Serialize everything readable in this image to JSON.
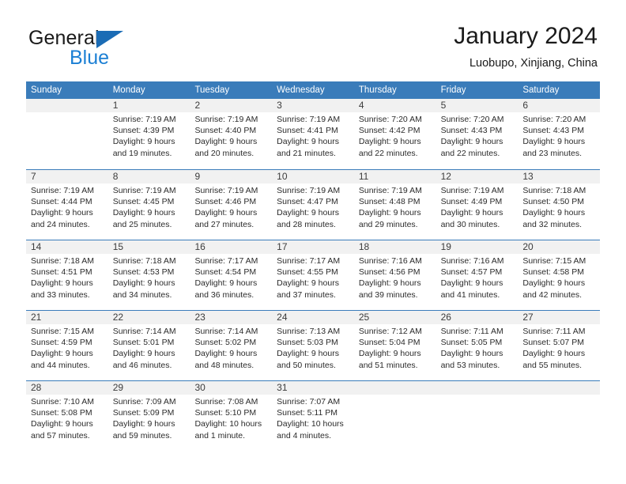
{
  "brand": {
    "name_part1": "General",
    "name_part2": "Blue",
    "color_primary": "#1b6cb5",
    "color_secondary": "#1b7fd4"
  },
  "header": {
    "title": "January 2024",
    "subtitle": "Luobupo, Xinjiang, China"
  },
  "calendar": {
    "header_bg": "#3a7cba",
    "header_text_color": "#ffffff",
    "weekdays": [
      "Sunday",
      "Monday",
      "Tuesday",
      "Wednesday",
      "Thursday",
      "Friday",
      "Saturday"
    ],
    "weeks": [
      [
        {
          "day": "",
          "sunrise": "",
          "sunset": "",
          "daylight_line1": "",
          "daylight_line2": ""
        },
        {
          "day": "1",
          "sunrise": "Sunrise: 7:19 AM",
          "sunset": "Sunset: 4:39 PM",
          "daylight_line1": "Daylight: 9 hours",
          "daylight_line2": "and 19 minutes."
        },
        {
          "day": "2",
          "sunrise": "Sunrise: 7:19 AM",
          "sunset": "Sunset: 4:40 PM",
          "daylight_line1": "Daylight: 9 hours",
          "daylight_line2": "and 20 minutes."
        },
        {
          "day": "3",
          "sunrise": "Sunrise: 7:19 AM",
          "sunset": "Sunset: 4:41 PM",
          "daylight_line1": "Daylight: 9 hours",
          "daylight_line2": "and 21 minutes."
        },
        {
          "day": "4",
          "sunrise": "Sunrise: 7:20 AM",
          "sunset": "Sunset: 4:42 PM",
          "daylight_line1": "Daylight: 9 hours",
          "daylight_line2": "and 22 minutes."
        },
        {
          "day": "5",
          "sunrise": "Sunrise: 7:20 AM",
          "sunset": "Sunset: 4:43 PM",
          "daylight_line1": "Daylight: 9 hours",
          "daylight_line2": "and 22 minutes."
        },
        {
          "day": "6",
          "sunrise": "Sunrise: 7:20 AM",
          "sunset": "Sunset: 4:43 PM",
          "daylight_line1": "Daylight: 9 hours",
          "daylight_line2": "and 23 minutes."
        }
      ],
      [
        {
          "day": "7",
          "sunrise": "Sunrise: 7:19 AM",
          "sunset": "Sunset: 4:44 PM",
          "daylight_line1": "Daylight: 9 hours",
          "daylight_line2": "and 24 minutes."
        },
        {
          "day": "8",
          "sunrise": "Sunrise: 7:19 AM",
          "sunset": "Sunset: 4:45 PM",
          "daylight_line1": "Daylight: 9 hours",
          "daylight_line2": "and 25 minutes."
        },
        {
          "day": "9",
          "sunrise": "Sunrise: 7:19 AM",
          "sunset": "Sunset: 4:46 PM",
          "daylight_line1": "Daylight: 9 hours",
          "daylight_line2": "and 27 minutes."
        },
        {
          "day": "10",
          "sunrise": "Sunrise: 7:19 AM",
          "sunset": "Sunset: 4:47 PM",
          "daylight_line1": "Daylight: 9 hours",
          "daylight_line2": "and 28 minutes."
        },
        {
          "day": "11",
          "sunrise": "Sunrise: 7:19 AM",
          "sunset": "Sunset: 4:48 PM",
          "daylight_line1": "Daylight: 9 hours",
          "daylight_line2": "and 29 minutes."
        },
        {
          "day": "12",
          "sunrise": "Sunrise: 7:19 AM",
          "sunset": "Sunset: 4:49 PM",
          "daylight_line1": "Daylight: 9 hours",
          "daylight_line2": "and 30 minutes."
        },
        {
          "day": "13",
          "sunrise": "Sunrise: 7:18 AM",
          "sunset": "Sunset: 4:50 PM",
          "daylight_line1": "Daylight: 9 hours",
          "daylight_line2": "and 32 minutes."
        }
      ],
      [
        {
          "day": "14",
          "sunrise": "Sunrise: 7:18 AM",
          "sunset": "Sunset: 4:51 PM",
          "daylight_line1": "Daylight: 9 hours",
          "daylight_line2": "and 33 minutes."
        },
        {
          "day": "15",
          "sunrise": "Sunrise: 7:18 AM",
          "sunset": "Sunset: 4:53 PM",
          "daylight_line1": "Daylight: 9 hours",
          "daylight_line2": "and 34 minutes."
        },
        {
          "day": "16",
          "sunrise": "Sunrise: 7:17 AM",
          "sunset": "Sunset: 4:54 PM",
          "daylight_line1": "Daylight: 9 hours",
          "daylight_line2": "and 36 minutes."
        },
        {
          "day": "17",
          "sunrise": "Sunrise: 7:17 AM",
          "sunset": "Sunset: 4:55 PM",
          "daylight_line1": "Daylight: 9 hours",
          "daylight_line2": "and 37 minutes."
        },
        {
          "day": "18",
          "sunrise": "Sunrise: 7:16 AM",
          "sunset": "Sunset: 4:56 PM",
          "daylight_line1": "Daylight: 9 hours",
          "daylight_line2": "and 39 minutes."
        },
        {
          "day": "19",
          "sunrise": "Sunrise: 7:16 AM",
          "sunset": "Sunset: 4:57 PM",
          "daylight_line1": "Daylight: 9 hours",
          "daylight_line2": "and 41 minutes."
        },
        {
          "day": "20",
          "sunrise": "Sunrise: 7:15 AM",
          "sunset": "Sunset: 4:58 PM",
          "daylight_line1": "Daylight: 9 hours",
          "daylight_line2": "and 42 minutes."
        }
      ],
      [
        {
          "day": "21",
          "sunrise": "Sunrise: 7:15 AM",
          "sunset": "Sunset: 4:59 PM",
          "daylight_line1": "Daylight: 9 hours",
          "daylight_line2": "and 44 minutes."
        },
        {
          "day": "22",
          "sunrise": "Sunrise: 7:14 AM",
          "sunset": "Sunset: 5:01 PM",
          "daylight_line1": "Daylight: 9 hours",
          "daylight_line2": "and 46 minutes."
        },
        {
          "day": "23",
          "sunrise": "Sunrise: 7:14 AM",
          "sunset": "Sunset: 5:02 PM",
          "daylight_line1": "Daylight: 9 hours",
          "daylight_line2": "and 48 minutes."
        },
        {
          "day": "24",
          "sunrise": "Sunrise: 7:13 AM",
          "sunset": "Sunset: 5:03 PM",
          "daylight_line1": "Daylight: 9 hours",
          "daylight_line2": "and 50 minutes."
        },
        {
          "day": "25",
          "sunrise": "Sunrise: 7:12 AM",
          "sunset": "Sunset: 5:04 PM",
          "daylight_line1": "Daylight: 9 hours",
          "daylight_line2": "and 51 minutes."
        },
        {
          "day": "26",
          "sunrise": "Sunrise: 7:11 AM",
          "sunset": "Sunset: 5:05 PM",
          "daylight_line1": "Daylight: 9 hours",
          "daylight_line2": "and 53 minutes."
        },
        {
          "day": "27",
          "sunrise": "Sunrise: 7:11 AM",
          "sunset": "Sunset: 5:07 PM",
          "daylight_line1": "Daylight: 9 hours",
          "daylight_line2": "and 55 minutes."
        }
      ],
      [
        {
          "day": "28",
          "sunrise": "Sunrise: 7:10 AM",
          "sunset": "Sunset: 5:08 PM",
          "daylight_line1": "Daylight: 9 hours",
          "daylight_line2": "and 57 minutes."
        },
        {
          "day": "29",
          "sunrise": "Sunrise: 7:09 AM",
          "sunset": "Sunset: 5:09 PM",
          "daylight_line1": "Daylight: 9 hours",
          "daylight_line2": "and 59 minutes."
        },
        {
          "day": "30",
          "sunrise": "Sunrise: 7:08 AM",
          "sunset": "Sunset: 5:10 PM",
          "daylight_line1": "Daylight: 10 hours",
          "daylight_line2": "and 1 minute."
        },
        {
          "day": "31",
          "sunrise": "Sunrise: 7:07 AM",
          "sunset": "Sunset: 5:11 PM",
          "daylight_line1": "Daylight: 10 hours",
          "daylight_line2": "and 4 minutes."
        },
        {
          "day": "",
          "sunrise": "",
          "sunset": "",
          "daylight_line1": "",
          "daylight_line2": ""
        },
        {
          "day": "",
          "sunrise": "",
          "sunset": "",
          "daylight_line1": "",
          "daylight_line2": ""
        },
        {
          "day": "",
          "sunrise": "",
          "sunset": "",
          "daylight_line1": "",
          "daylight_line2": ""
        }
      ]
    ]
  }
}
